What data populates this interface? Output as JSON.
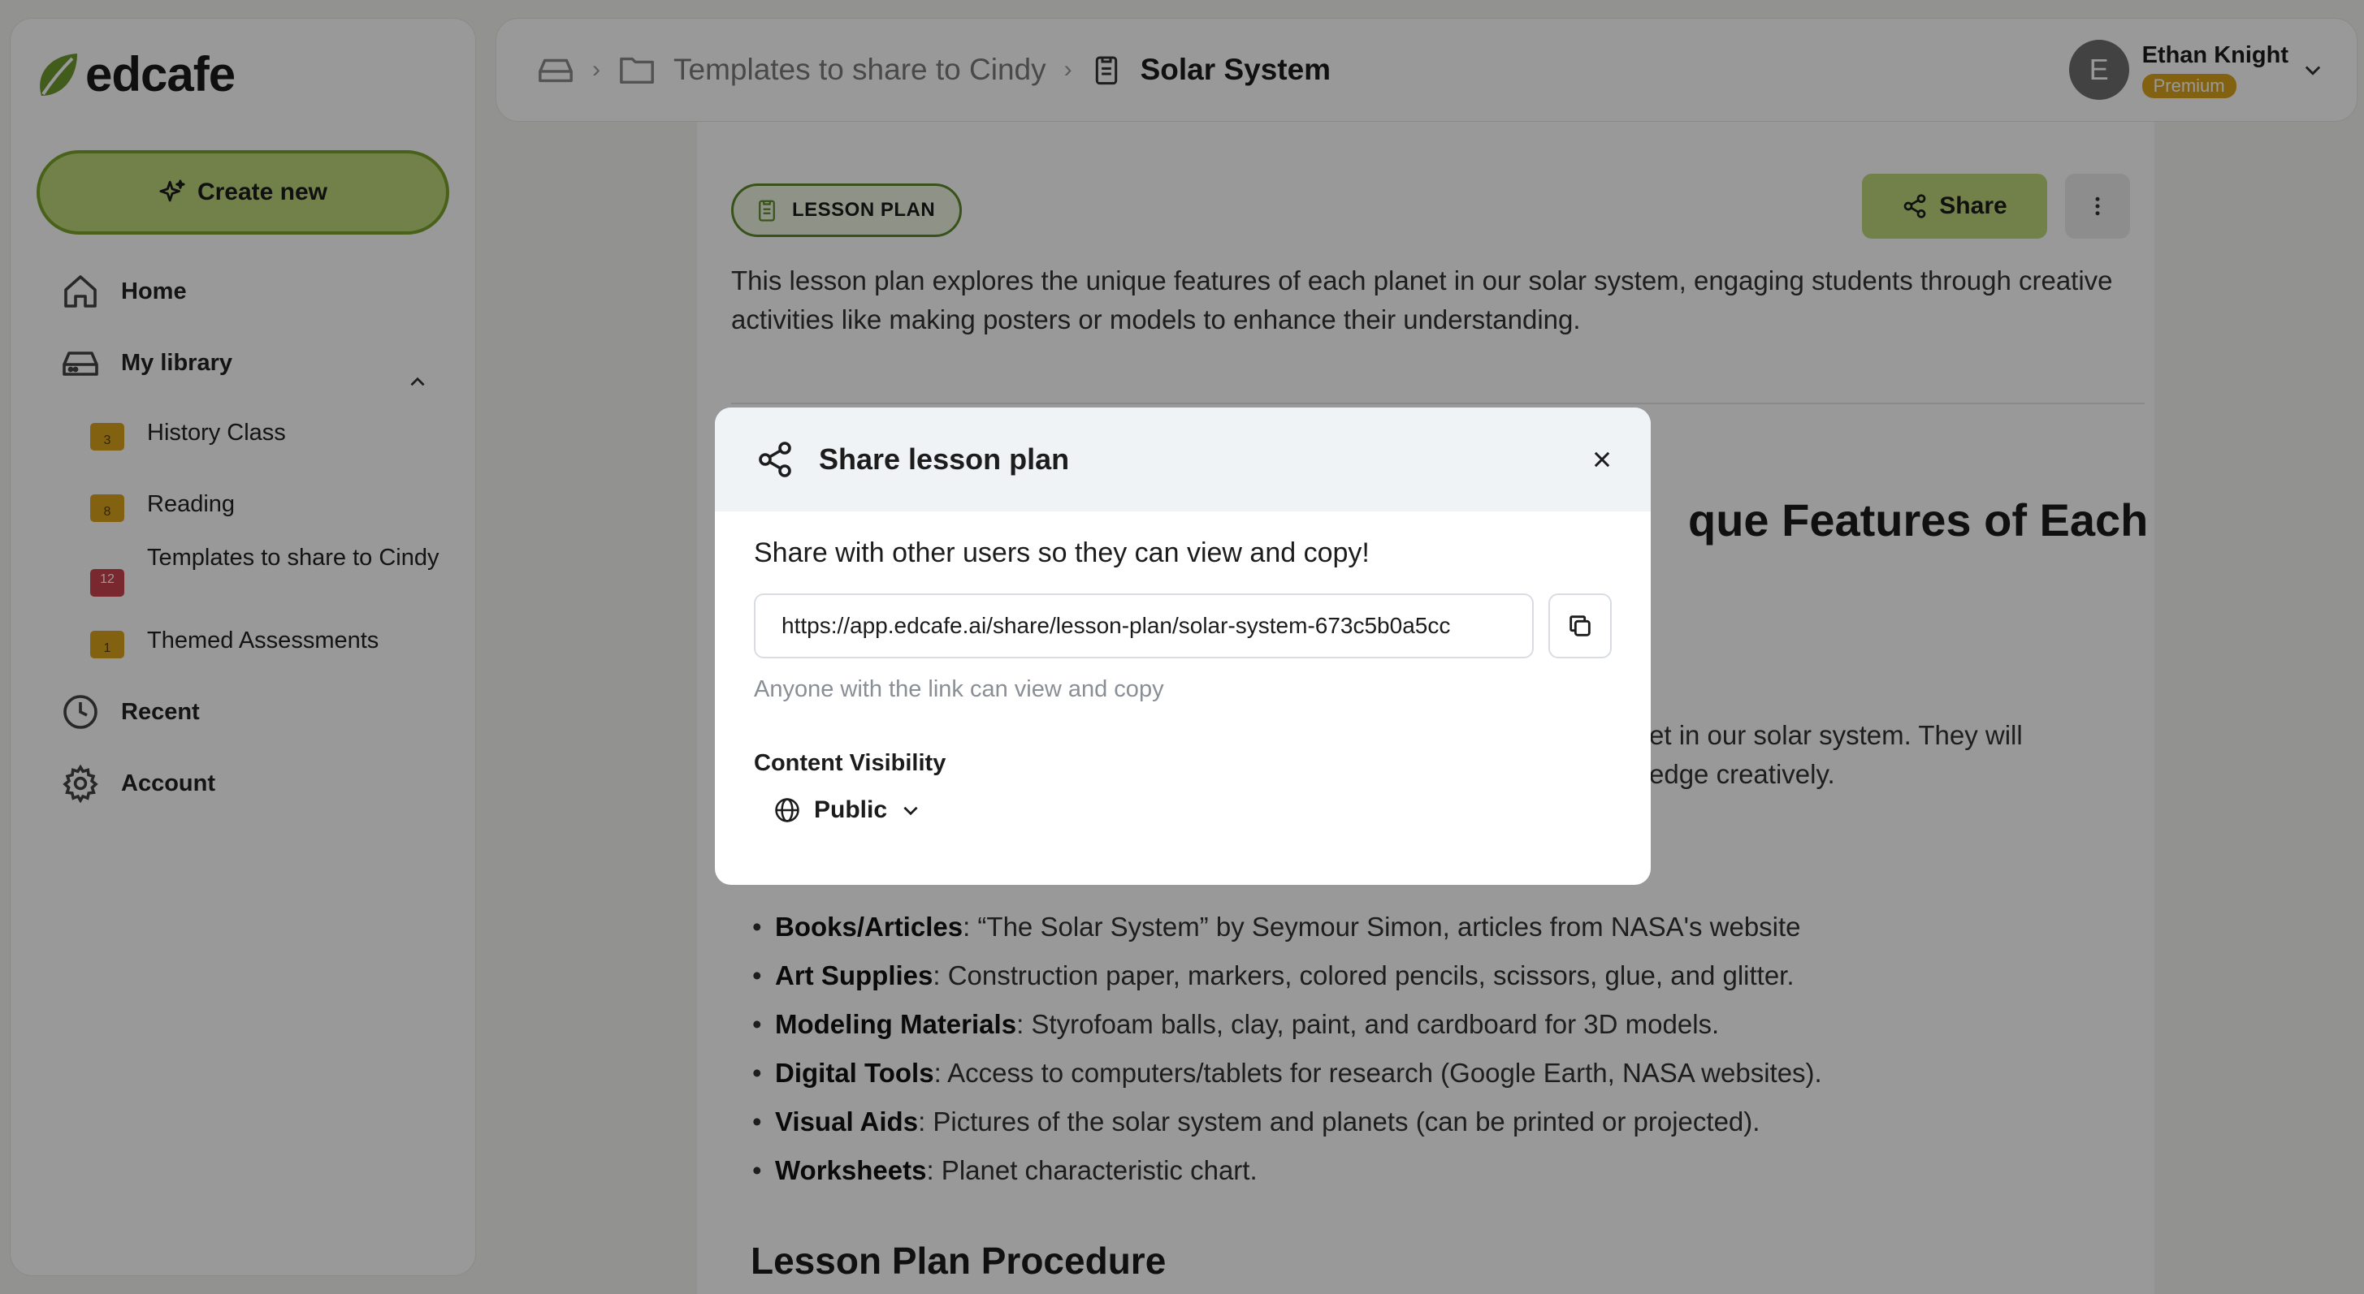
{
  "brand": {
    "name": "edcafe",
    "accent": "#bcd77b",
    "accent_border": "#7aa22a"
  },
  "sidebar": {
    "create_label": "Create new",
    "home_label": "Home",
    "library_label": "My library",
    "folders": [
      {
        "label": "History Class",
        "count": "3",
        "color": "#d9a21b"
      },
      {
        "label": "Reading",
        "count": "8",
        "color": "#d9a21b"
      },
      {
        "label": "Templates to share to Cindy",
        "count": "12",
        "color": "#c8434d"
      },
      {
        "label": "Themed Assessments",
        "count": "1",
        "color": "#d9a21b"
      }
    ],
    "recent_label": "Recent",
    "account_label": "Account"
  },
  "header": {
    "folder_crumb": "Templates to share to Cindy",
    "current_crumb": "Solar System",
    "user_name": "Ethan Knight",
    "user_initial": "E",
    "plan_badge": "Premium"
  },
  "doc": {
    "tag": "LESSON PLAN",
    "share_label": "Share",
    "description": "This lesson plan explores the unique features of each planet in our solar system, engaging students through creative activities like making posters or models to enhance their understanding.",
    "title_fragment": "que Features of Each",
    "para_line1": "et in our solar system. They will",
    "para_line2": "edge creatively.",
    "materials": [
      {
        "name": "Books/Articles",
        "text": ": “The Solar System” by Seymour Simon, articles from NASA's website"
      },
      {
        "name": "Art Supplies",
        "text": ": Construction paper, markers, colored pencils, scissors, glue, and glitter."
      },
      {
        "name": "Modeling Materials",
        "text": ": Styrofoam balls, clay, paint, and cardboard for 3D models."
      },
      {
        "name": "Digital Tools",
        "text": ": Access to computers/tablets for research (Google Earth, NASA websites)."
      },
      {
        "name": "Visual Aids",
        "text": ": Pictures of the solar system and planets (can be printed or projected)."
      },
      {
        "name": "Worksheets",
        "text": ": Planet characteristic chart."
      }
    ],
    "procedure_heading": "Lesson Plan Procedure"
  },
  "modal": {
    "title": "Share lesson plan",
    "subtitle": "Share with other users so they can view and copy!",
    "link_value": "https://app.edcafe.ai/share/lesson-plan/solar-system-673c5b0a5cc",
    "hint": "Anyone with the link can view and copy",
    "visibility_label": "Content Visibility",
    "visibility_value": "Public"
  }
}
